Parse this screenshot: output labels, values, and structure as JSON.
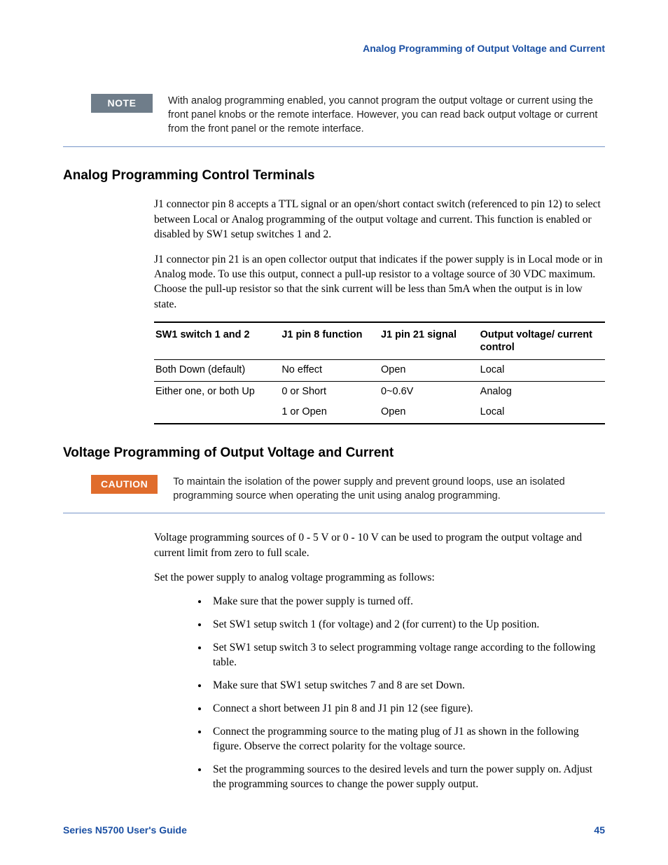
{
  "running_head": "Analog Programming of Output Voltage and Current",
  "note": {
    "label": "NOTE",
    "text": "With analog programming enabled, you cannot program the output voltage or current using the front panel knobs or the remote interface. However, you can read back output voltage or current from the front panel or the remote interface."
  },
  "section1": {
    "title": "Analog Programming Control Terminals",
    "para1": "J1 connector pin 8 accepts a TTL signal or an open/short contact switch (referenced to pin 12) to select between Local or Analog programming of the output voltage and current. This function is enabled or disabled by SW1 setup switches 1 and 2.",
    "para2": "J1 connector pin 21 is an open collector output that indicates if the power supply is in Local mode or in Analog mode. To use this output, connect a pull-up resistor to a voltage source of 30 VDC maximum. Choose the pull-up resistor so that the sink current will be less than 5mA when the output is in low state."
  },
  "table": {
    "headers": {
      "c0": "SW1 switch 1 and 2",
      "c1": "J1 pin 8 function",
      "c2": "J1 pin 21 signal",
      "c3": "Output voltage/ current control"
    },
    "rows": [
      {
        "c0": "Both Down (default)",
        "c1": "No effect",
        "c2": "Open",
        "c3": "Local"
      },
      {
        "c0": "Either one, or both Up",
        "c1": "0 or Short",
        "c2": "0~0.6V",
        "c3": "Analog"
      },
      {
        "c0": "",
        "c1": "1 or Open",
        "c2": "Open",
        "c3": "Local"
      }
    ]
  },
  "section2": {
    "title": "Voltage Programming of Output Voltage and Current"
  },
  "caution": {
    "label": "CAUTION",
    "text": "To maintain the isolation of the power supply and prevent ground loops, use an isolated programming source when operating the unit using analog programming."
  },
  "body2": {
    "para1": "Voltage programming sources of 0 - 5 V or 0 - 10 V can be used to program the output voltage and current limit from zero to full scale.",
    "para2": "Set the power supply to analog voltage programming as follows:",
    "bullets": [
      "Make sure that the power supply is turned off.",
      "Set SW1 setup switch 1 (for voltage) and 2 (for current) to the Up position.",
      "Set SW1 setup switch 3 to select programming voltage range according to the following table.",
      "Make sure that SW1 setup switches 7 and 8 are set Down.",
      "Connect a short between J1 pin 8 and J1 pin 12 (see figure).",
      "Connect the programming source to the mating plug of J1 as shown in the following figure. Observe the correct polarity for the voltage source.",
      "Set the programming sources to the desired levels and turn the power supply on. Adjust the programming sources to change the power supply output."
    ]
  },
  "footer": {
    "left": "Series N5700 User's Guide",
    "right": "45"
  }
}
